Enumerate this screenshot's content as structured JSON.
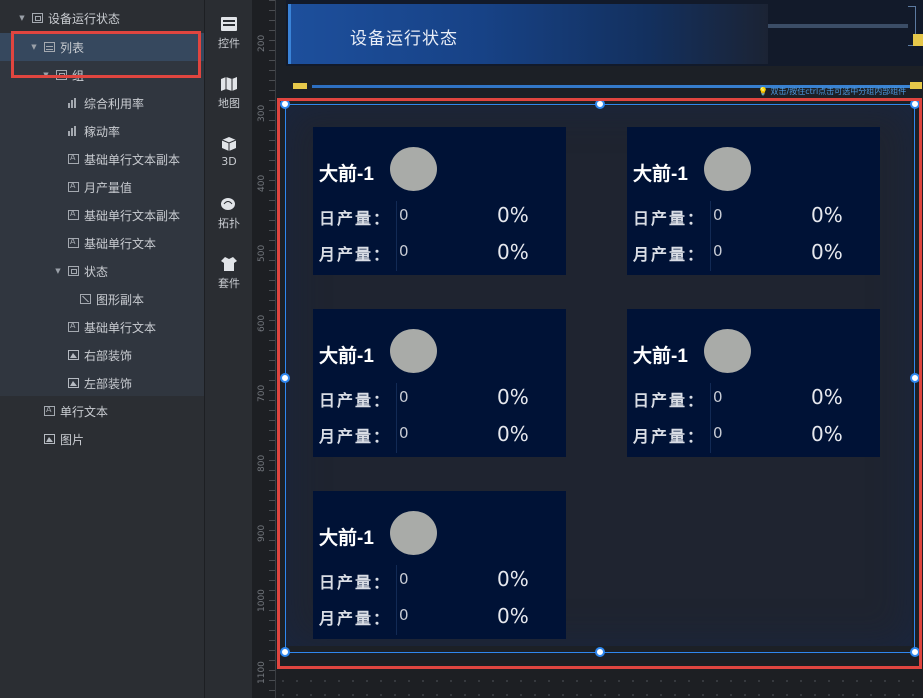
{
  "layer_tree": {
    "items": [
      {
        "label": "设备运行状态",
        "icon": "group-icon"
      },
      {
        "label": "列表",
        "icon": "list-icon"
      },
      {
        "label": "组",
        "icon": "group-icon"
      },
      {
        "label": "综合利用率",
        "icon": "bar-chart-icon"
      },
      {
        "label": "稼动率",
        "icon": "bar-chart-icon"
      },
      {
        "label": "基础单行文本副本",
        "icon": "text-icon"
      },
      {
        "label": "月产量值",
        "icon": "text-icon"
      },
      {
        "label": "基础单行文本副本",
        "icon": "text-icon"
      },
      {
        "label": "基础单行文本",
        "icon": "text-icon"
      },
      {
        "label": "状态",
        "icon": "group-icon"
      },
      {
        "label": "图形副本",
        "icon": "shape-icon"
      },
      {
        "label": "基础单行文本",
        "icon": "text-icon"
      },
      {
        "label": "右部装饰",
        "icon": "image-icon"
      },
      {
        "label": "左部装饰",
        "icon": "image-icon"
      },
      {
        "label": "单行文本",
        "icon": "text-icon"
      },
      {
        "label": "图片",
        "icon": "image-icon"
      }
    ]
  },
  "toolbar": {
    "items": [
      {
        "label": "控件",
        "icon": "widget-icon"
      },
      {
        "label": "地图",
        "icon": "map-icon"
      },
      {
        "label": "3D",
        "icon": "cube-icon"
      },
      {
        "label": "拓扑",
        "icon": "topology-icon"
      },
      {
        "label": "套件",
        "icon": "shirt-icon"
      }
    ]
  },
  "ruler": {
    "ticks": [
      "200",
      "300",
      "400",
      "500",
      "600",
      "700",
      "800",
      "900",
      "1000",
      "1100"
    ]
  },
  "canvas": {
    "title": "设备运行状态",
    "hint": "双击/按住ctrl点击可选中分组内部组件",
    "cards": [
      {
        "name": "大前-1",
        "daily_label": "日产量：",
        "daily_value": "0",
        "daily_pct": "0%",
        "monthly_label": "月产量：",
        "monthly_value": "0",
        "monthly_pct": "0%"
      },
      {
        "name": "大前-1",
        "daily_label": "日产量：",
        "daily_value": "0",
        "daily_pct": "0%",
        "monthly_label": "月产量：",
        "monthly_value": "0",
        "monthly_pct": "0%"
      },
      {
        "name": "大前-1",
        "daily_label": "日产量：",
        "daily_value": "0",
        "daily_pct": "0%",
        "monthly_label": "月产量：",
        "monthly_value": "0",
        "monthly_pct": "0%"
      },
      {
        "name": "大前-1",
        "daily_label": "日产量：",
        "daily_value": "0",
        "daily_pct": "0%",
        "monthly_label": "月产量：",
        "monthly_value": "0",
        "monthly_pct": "0%"
      },
      {
        "name": "大前-1",
        "daily_label": "日产量：",
        "daily_value": "0",
        "daily_pct": "0%",
        "monthly_label": "月产量：",
        "monthly_value": "0",
        "monthly_pct": "0%"
      }
    ]
  },
  "colors": {
    "selection": "#e0453f",
    "accent": "#2f87ee",
    "card_bg": "#001236",
    "highlight": "#e6c84a"
  }
}
